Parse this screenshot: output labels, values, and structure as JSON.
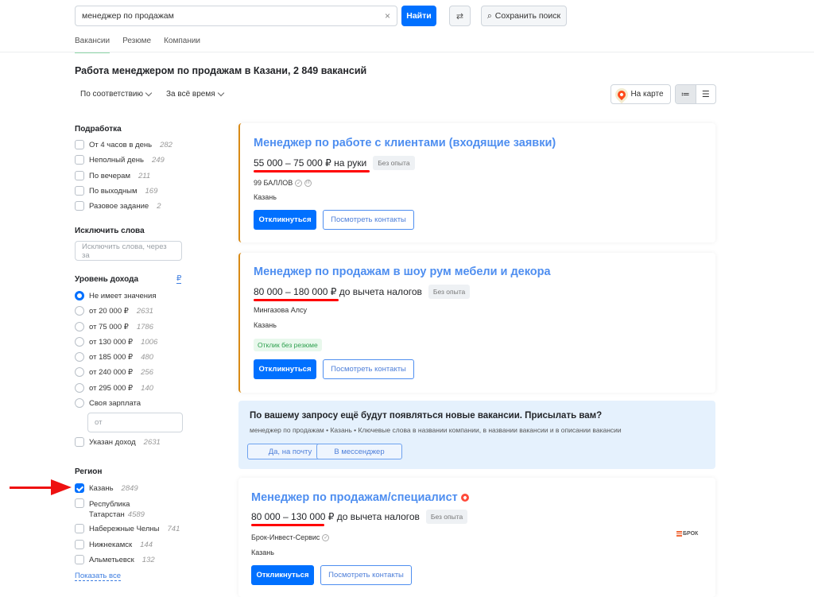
{
  "header": {
    "search_value": "менеджер по продажам",
    "clear_icon": "×",
    "find_label": "Найти",
    "settings_icon": "⇄",
    "save_search_label": "Сохранить поиск",
    "save_search_icon": "⌕"
  },
  "tabs": [
    {
      "label": "Вакансии",
      "active": true
    },
    {
      "label": "Резюме",
      "active": false
    },
    {
      "label": "Компании",
      "active": false
    }
  ],
  "page_title": "Работа менеджером по продажам в Казани, 2 849 вакансий",
  "sort": {
    "relevance": "По соответствию",
    "period": "За всё время"
  },
  "view": {
    "map_label": "На карте",
    "list_compact_icon": "≔",
    "list_full_icon": "☰"
  },
  "sidebar": {
    "part_time": {
      "heading": "Подработка",
      "items": [
        {
          "label": "От 4 часов в день",
          "count": "282",
          "checked": false
        },
        {
          "label": "Неполный день",
          "count": "249",
          "checked": false
        },
        {
          "label": "По вечерам",
          "count": "211",
          "checked": false
        },
        {
          "label": "По выходным",
          "count": "169",
          "checked": false
        },
        {
          "label": "Разовое задание",
          "count": "2",
          "checked": false
        }
      ]
    },
    "exclude": {
      "heading": "Исключить слова",
      "placeholder": "Исключить слова, через за"
    },
    "income": {
      "heading": "Уровень дохода",
      "currency_icon": "₽",
      "options": [
        {
          "label": "Не имеет значения",
          "count": "",
          "selected": true
        },
        {
          "label": "от 20 000 ₽",
          "count": "2631",
          "selected": false
        },
        {
          "label": "от 75 000 ₽",
          "count": "1786",
          "selected": false
        },
        {
          "label": "от 130 000 ₽",
          "count": "1006",
          "selected": false
        },
        {
          "label": "от 185 000 ₽",
          "count": "480",
          "selected": false
        },
        {
          "label": "от 240 000 ₽",
          "count": "256",
          "selected": false
        },
        {
          "label": "от 295 000 ₽",
          "count": "140",
          "selected": false
        },
        {
          "label": "Своя зарплата",
          "count": "",
          "selected": false
        }
      ],
      "custom_placeholder": "от",
      "specified": {
        "label": "Указан доход",
        "count": "2631",
        "checked": false
      }
    },
    "region": {
      "heading": "Регион",
      "items": [
        {
          "label": "Казань",
          "count": "2849",
          "checked": true
        },
        {
          "label": "Республика",
          "label2": "Татарстан",
          "count": "4589",
          "checked": false
        },
        {
          "label": "Набережные Челны",
          "count": "741",
          "checked": false
        },
        {
          "label": "Нижнекамск",
          "count": "144",
          "checked": false
        },
        {
          "label": "Альметьевск",
          "count": "132",
          "checked": false
        }
      ],
      "show_all": "Показать все"
    }
  },
  "vacancies": [
    {
      "title": "Менеджер по работе с клиентами (входящие заявки)",
      "salary": "55 000 – 75 000 ₽",
      "salary_note": "на руки",
      "experience": "Без опыта",
      "company": "99 БАЛЛОВ",
      "city": "Казань",
      "apply": "Откликнуться",
      "contacts": "Посмотреть контакты"
    },
    {
      "title": "Менеджер по продажам в шоу рум мебели и декора",
      "salary": "80 000 – 180 000 ₽",
      "salary_note": "до вычета налогов",
      "experience": "Без опыта",
      "company": "Мингазова Алсу",
      "city": "Казань",
      "badge": "Отклик без резюме",
      "apply": "Откликнуться",
      "contacts": "Посмотреть контакты"
    },
    {
      "title": "Менеджер по продажам/специалист",
      "salary": "80 000 – 130 000 ₽",
      "salary_note": "до вычета налогов",
      "experience": "Без опыта",
      "company": "Брок-Инвест-Сервис",
      "company_logo": "БРОК",
      "city": "Казань",
      "apply": "Откликнуться",
      "contacts": "Посмотреть контакты"
    }
  ],
  "promo": {
    "title": "По вашему запросу ещё будут появляться новые вакансии. Присылать вам?",
    "subtitle": "менеджер по продажам • Казань • Ключевые слова в названии компании, в названии вакансии и в описании вакансии",
    "email_button": "Да, на почту",
    "messenger_button": "В мессенджер"
  }
}
